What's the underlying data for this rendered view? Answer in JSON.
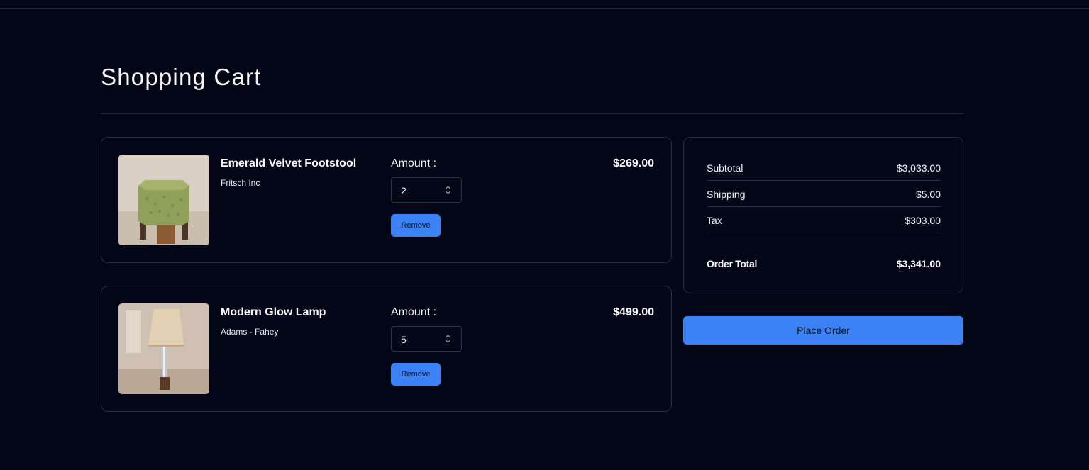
{
  "page": {
    "title": "Shopping Cart"
  },
  "cart": {
    "amount_label": "Amount :",
    "remove_label": "Remove",
    "items": [
      {
        "name": "Emerald Velvet Footstool",
        "brand": "Fritsch Inc",
        "quantity": "2",
        "price": "$269.00",
        "image": "green-velvet-footstool-photo"
      },
      {
        "name": "Modern Glow Lamp",
        "brand": "Adams - Fahey",
        "quantity": "5",
        "price": "$499.00",
        "image": "table-lamp-photo"
      }
    ]
  },
  "summary": {
    "subtotal_label": "Subtotal",
    "subtotal_value": "$3,033.00",
    "shipping_label": "Shipping",
    "shipping_value": "$5.00",
    "tax_label": "Tax",
    "tax_value": "$303.00",
    "total_label": "Order Total",
    "total_value": "$3,341.00"
  },
  "actions": {
    "place_order_label": "Place Order"
  },
  "colors": {
    "background": "#020617",
    "accent": "#3b82f6",
    "border": "#263041"
  }
}
